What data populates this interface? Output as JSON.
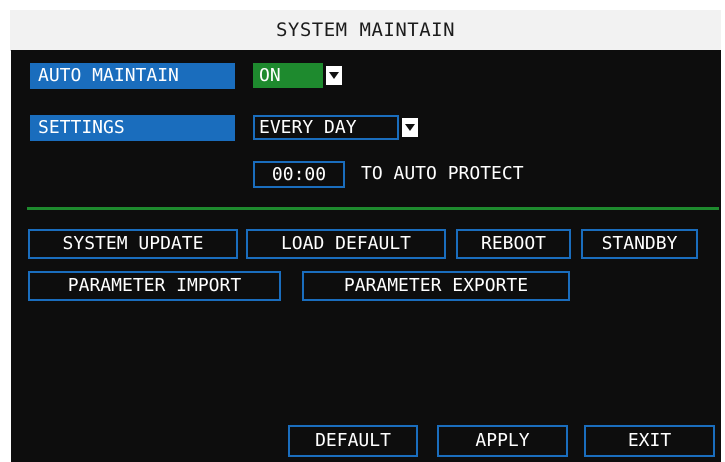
{
  "window": {
    "title": "SYSTEM MAINTAIN"
  },
  "auto_maintain": {
    "label": "AUTO MAINTAIN",
    "value": "ON"
  },
  "settings": {
    "label": "SETTINGS",
    "value": "EVERY DAY"
  },
  "schedule": {
    "time": "00:00",
    "suffix": "TO AUTO PROTECT"
  },
  "actions": {
    "system_update": "SYSTEM UPDATE",
    "load_default": "LOAD DEFAULT",
    "reboot": "REBOOT",
    "standby": "STANDBY",
    "parameter_import": "PARAMETER IMPORT",
    "parameter_export": "PARAMETER EXPORTE"
  },
  "footer": {
    "default": "DEFAULT",
    "apply": "APPLY",
    "exit": "EXIT"
  },
  "colors": {
    "panel_bg": "#0d0d0d",
    "label_blue": "#1a6dbd",
    "toggle_green": "#1e8a2e",
    "divider_green": "#1e8a2e",
    "title_bg": "#f2f2f2"
  },
  "icons": {
    "dropdown": "chevron-down-icon"
  }
}
